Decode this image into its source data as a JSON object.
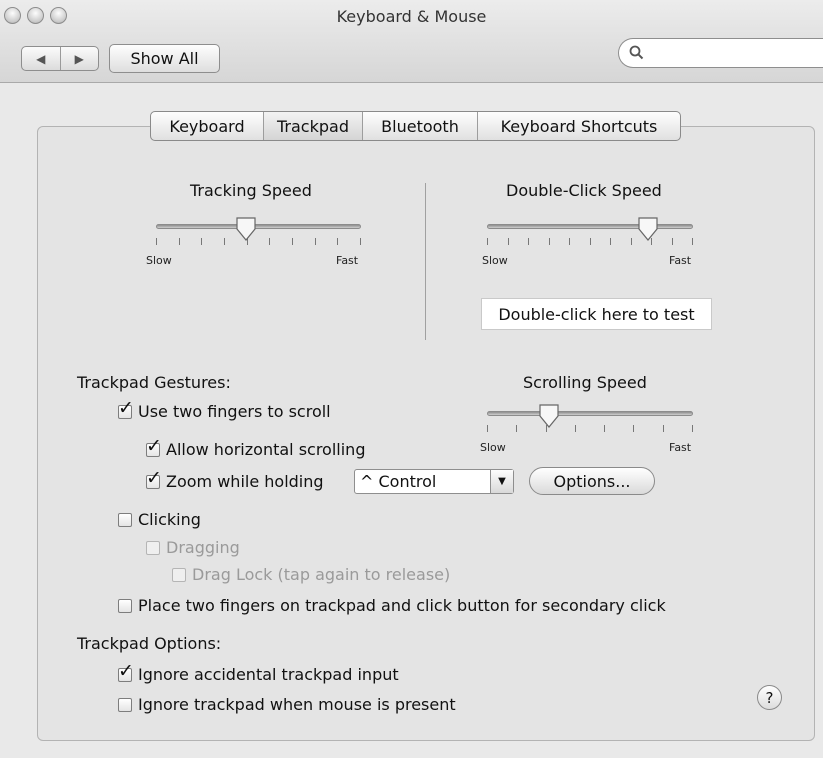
{
  "window": {
    "title": "Keyboard & Mouse",
    "nav_back": "◀",
    "nav_forward": "▶",
    "show_all": "Show All",
    "search_placeholder": ""
  },
  "tabs": [
    {
      "label": "Keyboard",
      "selected": false
    },
    {
      "label": "Trackpad",
      "selected": true
    },
    {
      "label": "Bluetooth",
      "selected": false
    },
    {
      "label": "Keyboard Shortcuts",
      "selected": false
    }
  ],
  "tracking_speed": {
    "label": "Tracking Speed",
    "min_label": "Slow",
    "max_label": "Fast",
    "tick_count": 10,
    "value_fraction": 0.44
  },
  "double_click_speed": {
    "label": "Double-Click Speed",
    "min_label": "Slow",
    "max_label": "Fast",
    "tick_count": 11,
    "value_fraction": 0.78,
    "test_field": "Double-click here to test"
  },
  "gestures": {
    "heading": "Trackpad Gestures:",
    "two_finger_scroll": {
      "label": "Use two fingers to scroll",
      "checked": true
    },
    "horizontal_scroll": {
      "label": "Allow horizontal scrolling",
      "checked": true
    },
    "zoom": {
      "label": "Zoom while holding",
      "checked": true,
      "modifier": "^ Control"
    },
    "options_button": "Options...",
    "clicking": {
      "label": "Clicking",
      "checked": false
    },
    "dragging": {
      "label": "Dragging",
      "checked": false,
      "enabled": false
    },
    "drag_lock": {
      "label": "Drag Lock (tap again to release)",
      "checked": false,
      "enabled": false
    },
    "secondary_click": {
      "label": "Place two fingers on trackpad and click button for secondary click",
      "checked": false
    }
  },
  "scrolling_speed": {
    "label": "Scrolling Speed",
    "min_label": "Slow",
    "max_label": "Fast",
    "tick_count": 8,
    "value_fraction": 0.3
  },
  "options": {
    "heading": "Trackpad Options:",
    "ignore_accidental": {
      "label": "Ignore accidental trackpad input",
      "checked": true
    },
    "ignore_with_mouse": {
      "label": "Ignore trackpad when mouse is present",
      "checked": false
    }
  },
  "help_label": "?",
  "check_glyph": "✓"
}
